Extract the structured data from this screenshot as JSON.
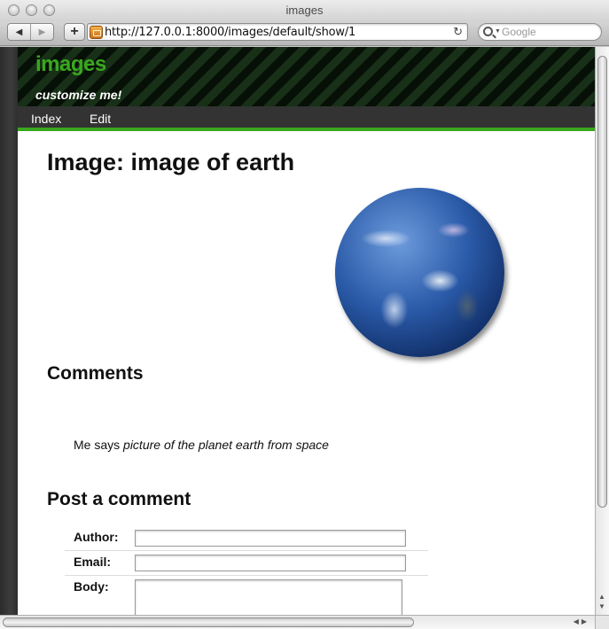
{
  "window": {
    "title": "images"
  },
  "toolbar": {
    "back_glyph": "◀",
    "forward_glyph": "▶",
    "add_glyph": "+",
    "url": "http://127.0.0.1:8000/images/default/show/1",
    "reload_glyph": "↻",
    "search_placeholder": "Google"
  },
  "site": {
    "title": "images",
    "tagline": "customize me!",
    "nav": [
      {
        "label": "Index"
      },
      {
        "label": "Edit"
      }
    ]
  },
  "page": {
    "title": "Image: image of earth",
    "comments_heading": "Comments",
    "comments": [
      {
        "author": "Me",
        "verb": " says ",
        "body": "picture of the planet earth from space"
      }
    ],
    "post_heading": "Post a comment",
    "form": {
      "author_label": "Author:",
      "email_label": "Email:",
      "body_label": "Body:"
    }
  },
  "colors": {
    "accent_green": "#3aa81e",
    "nav_bg": "#333333"
  }
}
